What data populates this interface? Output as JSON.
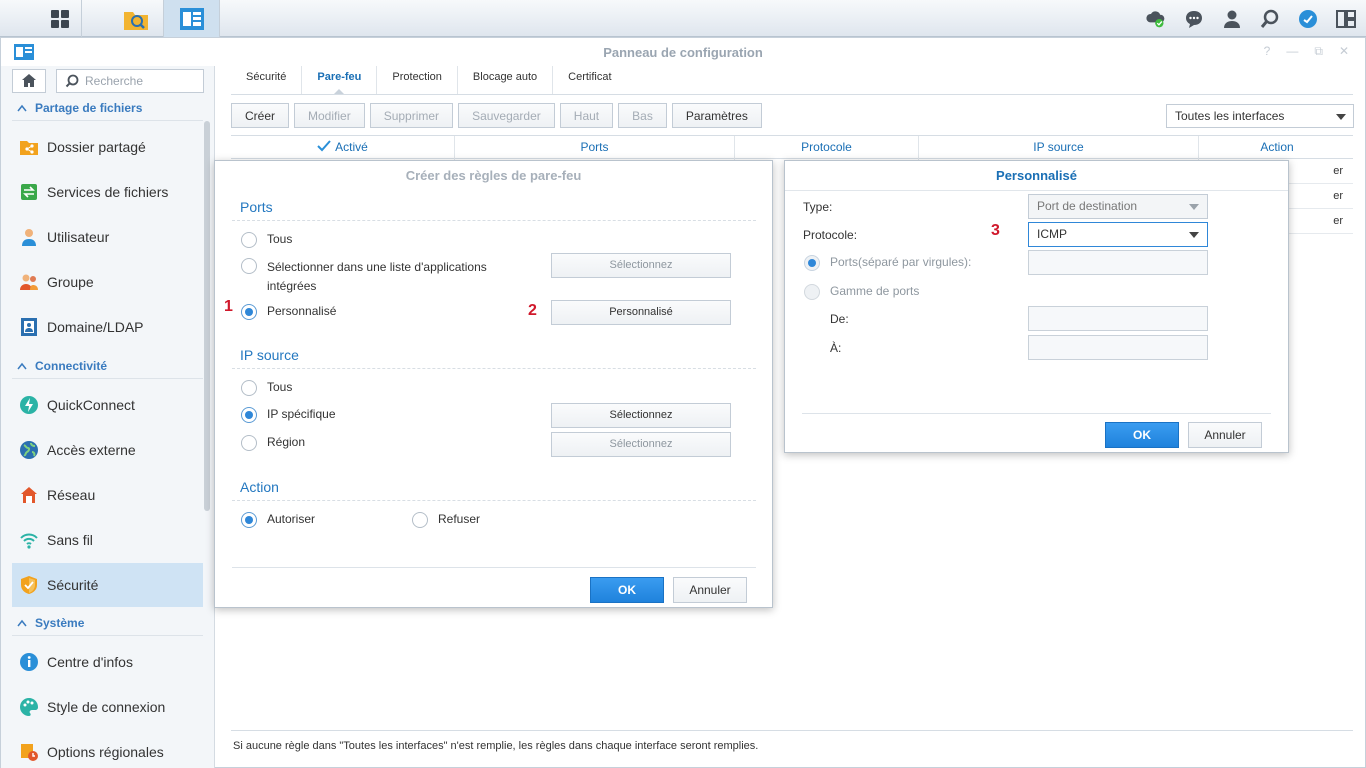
{
  "taskbar": {
    "icons": [
      "main-menu-icon",
      "file-station-icon",
      "control-panel-icon"
    ],
    "right_icons": [
      "cloud-sync-icon",
      "chat-icon",
      "user-icon",
      "search-icon",
      "widget-icon",
      "window-layout-icon"
    ]
  },
  "window": {
    "title": "Panneau de configuration",
    "controls": [
      "?",
      "—",
      "⧉",
      "✕"
    ]
  },
  "sidebar": {
    "search_placeholder": "Recherche",
    "sections": [
      {
        "label": "Partage de fichiers",
        "items": [
          "Dossier partagé",
          "Services de fichiers",
          "Utilisateur",
          "Groupe",
          "Domaine/LDAP"
        ]
      },
      {
        "label": "Connectivité",
        "items": [
          "QuickConnect",
          "Accès externe",
          "Réseau",
          "Sans fil",
          "Sécurité"
        ]
      },
      {
        "label": "Système",
        "items": [
          "Centre d'infos",
          "Style de connexion",
          "Options régionales"
        ]
      }
    ],
    "selected": "Sécurité"
  },
  "tabs": [
    "Sécurité",
    "Pare-feu",
    "Protection",
    "Blocage auto",
    "Certificat"
  ],
  "active_tab": "Pare-feu",
  "toolbar": {
    "create": "Créer",
    "modify": "Modifier",
    "delete": "Supprimer",
    "save": "Sauvegarder",
    "up": "Haut",
    "down": "Bas",
    "params": "Paramètres"
  },
  "interface_select": "Toutes les interfaces",
  "grid": {
    "headers": [
      "Activé",
      "Ports",
      "Protocole",
      "IP source",
      "Action"
    ],
    "row_fragments": [
      "er",
      "er",
      "er"
    ]
  },
  "footer_note": "Si aucune règle dans \"Toutes les interfaces\" n'est remplie, les règles dans chaque interface seront remplies.",
  "dialog_rules": {
    "title": "Créer des règles de pare-feu",
    "ports_label": "Ports",
    "ports_all": "Tous",
    "ports_list_line1": "Sélectionner dans une liste d'applications",
    "ports_list_line2": "intégrées",
    "ports_custom": "Personnalisé",
    "select_btn": "Sélectionnez",
    "custom_btn": "Personnalisé",
    "ip_label": "IP source",
    "ip_all": "Tous",
    "ip_specific": "IP spécifique",
    "ip_region": "Région",
    "action_label": "Action",
    "allow": "Autoriser",
    "deny": "Refuser",
    "ok": "OK",
    "cancel": "Annuler",
    "annotation_1": "1",
    "annotation_2": "2"
  },
  "dialog_custom": {
    "title": "Personnalisé",
    "type_label": "Type:",
    "type_value": "Port de destination",
    "protocol_label": "Protocole:",
    "protocol_value": "ICMP",
    "ports_label": "Ports(séparé par virgules):",
    "range_label": "Gamme de ports",
    "from_label": "De:",
    "to_label": "À:",
    "ok": "OK",
    "cancel": "Annuler",
    "annotation_3": "3"
  },
  "colors": {
    "accent": "#1a6fb5",
    "selected_nav": "#cfe3f4",
    "ok_button": "#2f87d8",
    "annotation": "#d0182b"
  }
}
